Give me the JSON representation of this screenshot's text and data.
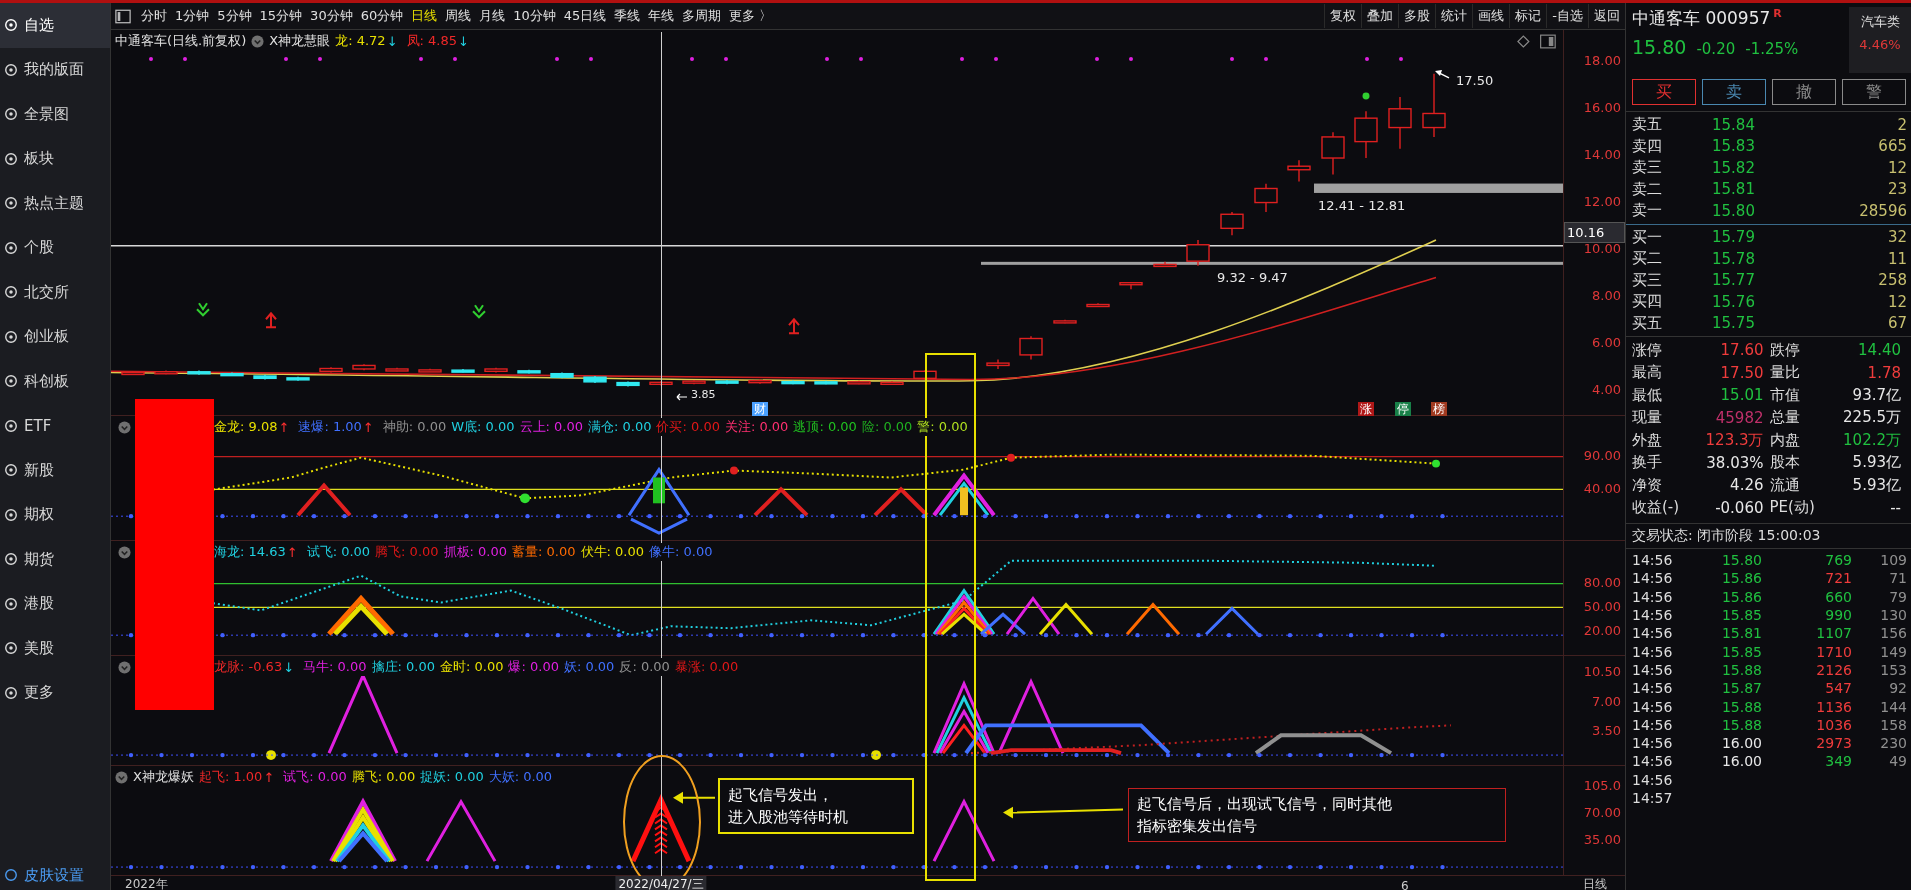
{
  "sidebar": {
    "items": [
      {
        "label": "自选",
        "selected": true
      },
      {
        "label": "我的版面",
        "selected": false
      },
      {
        "label": "全景图",
        "selected": false
      },
      {
        "label": "板块",
        "selected": false
      },
      {
        "label": "热点主题",
        "selected": false
      },
      {
        "label": "个股",
        "selected": false
      },
      {
        "label": "北交所",
        "selected": false
      },
      {
        "label": "创业板",
        "selected": false
      },
      {
        "label": "科创板",
        "selected": false
      },
      {
        "label": "ETF",
        "selected": false
      },
      {
        "label": "新股",
        "selected": false
      },
      {
        "label": "期权",
        "selected": false
      },
      {
        "label": "期货",
        "selected": false
      },
      {
        "label": "港股",
        "selected": false
      },
      {
        "label": "美股",
        "selected": false
      },
      {
        "label": "更多",
        "selected": false
      }
    ],
    "footer": "皮肤设置"
  },
  "chart_toolbar": {
    "periods": [
      {
        "label": "分时",
        "selected": false
      },
      {
        "label": "1分钟",
        "selected": false
      },
      {
        "label": "5分钟",
        "selected": false
      },
      {
        "label": "15分钟",
        "selected": false
      },
      {
        "label": "30分钟",
        "selected": false
      },
      {
        "label": "60分钟",
        "selected": false
      },
      {
        "label": "日线",
        "selected": true
      },
      {
        "label": "周线",
        "selected": false
      },
      {
        "label": "月线",
        "selected": false
      },
      {
        "label": "10分钟",
        "selected": false
      },
      {
        "label": "45日线",
        "selected": false
      },
      {
        "label": "季线",
        "selected": false
      },
      {
        "label": "年线",
        "selected": false
      },
      {
        "label": "多周期",
        "selected": false
      },
      {
        "label": "更多 〉",
        "selected": false
      }
    ],
    "tools": [
      "复权",
      "叠加",
      "多股",
      "统计",
      "画线",
      "标记",
      "-自选",
      "返回"
    ]
  },
  "main_chart": {
    "title": "中通客车(日线.前复权)",
    "indicator": "X神龙慧眼",
    "legend": [
      {
        "text": "龙: 4.72",
        "color": "#e8e000",
        "arrow": "↓",
        "arrow_up": false
      },
      {
        "text": "凤: 4.85",
        "color": "#f02828",
        "arrow": "↓",
        "arrow_up": false
      }
    ],
    "price_axis": [
      "18.00",
      "16.00",
      "14.00",
      "12.00",
      "10.00",
      "8.00",
      "6.00",
      "4.00"
    ],
    "current_price_tag": "10.16",
    "annotations": {
      "high": "17.50",
      "upper_zone": "12.41 - 12.81",
      "lower_zone": "9.32 - 9.47",
      "low": "3.85"
    },
    "markers": [
      {
        "text": "财",
        "color": "#4aa0ff"
      },
      {
        "text": "涨",
        "color": "#b01818"
      },
      {
        "text": "停",
        "color": "#188048"
      },
      {
        "text": "榜",
        "color": "#a03a20"
      }
    ]
  },
  "indicator_panels": [
    {
      "legend": [
        {
          "text": "金龙: 9.08",
          "color": "#e8e000",
          "arrow": "↑",
          "arrow_up": true
        },
        {
          "text": "速爆: 1.00",
          "color": "#4070ff",
          "arrow": "↑",
          "arrow_up": true
        },
        {
          "text": "神助: 0.00",
          "color": "#909090"
        },
        {
          "text": "W底: 0.00",
          "color": "#20d0e0"
        },
        {
          "text": "云上: 0.00",
          "color": "#e020e0"
        },
        {
          "text": "满仓: 0.00",
          "color": "#20d0e0"
        },
        {
          "text": "价买: 0.00",
          "color": "#e01818"
        },
        {
          "text": "关注: 0.00",
          "color": "#ff3070"
        },
        {
          "text": "逃顶: 0.00",
          "color": "#20c020"
        },
        {
          "text": "险: 0.00",
          "color": "#20b020"
        },
        {
          "text": "警: 0.00",
          "color": "#b0e020"
        }
      ],
      "axis": [
        "90.00",
        "40.00"
      ]
    },
    {
      "legend": [
        {
          "text": "海龙: 14.63",
          "color": "#20d0e0",
          "arrow": "↑",
          "arrow_up": true
        },
        {
          "text": "试飞: 0.00",
          "color": "#20d0e0"
        },
        {
          "text": "腾飞: 0.00",
          "color": "#e01818"
        },
        {
          "text": "抓板: 0.00",
          "color": "#e020e0"
        },
        {
          "text": "蓄量: 0.00",
          "color": "#ff6a00"
        },
        {
          "text": "伏牛: 0.00",
          "color": "#e8e000"
        },
        {
          "text": "像牛: 0.00",
          "color": "#4070ff"
        }
      ],
      "axis": [
        "80.00",
        "50.00",
        "20.00"
      ]
    },
    {
      "legend": [
        {
          "text": "龙脉: -0.63",
          "color": "#f02828",
          "arrow": "↓",
          "arrow_up": false
        },
        {
          "text": "马牛: 0.00",
          "color": "#e020e0"
        },
        {
          "text": "擒庄: 0.00",
          "color": "#20d0e0"
        },
        {
          "text": "金时: 0.00",
          "color": "#e8e000"
        },
        {
          "text": "爆: 0.00",
          "color": "#e020e0"
        },
        {
          "text": "妖: 0.00",
          "color": "#4070ff"
        },
        {
          "text": "反: 0.00",
          "color": "#909090"
        },
        {
          "text": "暴涨: 0.00",
          "color": "#e01818"
        }
      ],
      "axis": [
        "10.50",
        "7.00",
        "3.50"
      ]
    },
    {
      "title": "X神龙爆妖",
      "legend": [
        {
          "text": "起飞: 1.00",
          "color": "#f02828",
          "arrow": "↑",
          "arrow_up": true
        },
        {
          "text": "试飞: 0.00",
          "color": "#e020e0"
        },
        {
          "text": "腾飞: 0.00",
          "color": "#e8e000"
        },
        {
          "text": "捉妖: 0.00",
          "color": "#20d0e0"
        },
        {
          "text": "大妖: 0.00",
          "color": "#4070ff"
        }
      ],
      "axis": [
        "105.0",
        "70.00",
        "35.00"
      ],
      "notes": [
        [
          "起飞信号发出，",
          "进入股池等待时机"
        ],
        [
          "起飞信号后，出现试飞信号，同时其他",
          "指标密集发出信号"
        ]
      ]
    }
  ],
  "x_axis": {
    "start": "2022年",
    "cursor_date": "2022/04/27/三",
    "tick": "6",
    "period": "日线"
  },
  "quote": {
    "name": "中通客车 000957",
    "flag": "R",
    "sector": "汽车类",
    "sector_change": "4.46%",
    "price": "15.80",
    "change": "-0.20",
    "change_pct": "-1.25%",
    "buttons": [
      {
        "label": "买",
        "color": "#e03030"
      },
      {
        "label": "卖",
        "color": "#4a88b0"
      },
      {
        "label": "撤",
        "color": "#8a8a8a"
      },
      {
        "label": "警",
        "color": "#8a8a8a"
      }
    ],
    "asks": [
      {
        "label": "卖五",
        "price": "15.84",
        "volume": "2"
      },
      {
        "label": "卖四",
        "price": "15.83",
        "volume": "665"
      },
      {
        "label": "卖三",
        "price": "15.82",
        "volume": "12"
      },
      {
        "label": "卖二",
        "price": "15.81",
        "volume": "23"
      },
      {
        "label": "卖一",
        "price": "15.80",
        "volume": "28596"
      }
    ],
    "bids": [
      {
        "label": "买一",
        "price": "15.79",
        "volume": "32"
      },
      {
        "label": "买二",
        "price": "15.78",
        "volume": "11"
      },
      {
        "label": "买三",
        "price": "15.77",
        "volume": "258"
      },
      {
        "label": "买四",
        "price": "15.76",
        "volume": "12"
      },
      {
        "label": "买五",
        "price": "15.75",
        "volume": "67"
      }
    ],
    "stats": [
      {
        "label": "涨停",
        "value": "17.60",
        "color": "#f03c3c"
      },
      {
        "label": "跌停",
        "value": "14.40",
        "color": "#20c040"
      },
      {
        "label": "最高",
        "value": "17.50",
        "color": "#f03c3c"
      },
      {
        "label": "量比",
        "value": "1.78",
        "color": "#f03c3c"
      },
      {
        "label": "最低",
        "value": "15.01",
        "color": "#20c040"
      },
      {
        "label": "市值",
        "value": "93.7亿",
        "color": "#e8e8e8"
      },
      {
        "label": "现量",
        "value": "45982",
        "color": "#c0306a"
      },
      {
        "label": "总量",
        "value": "225.5万",
        "color": "#e8e8e8"
      },
      {
        "label": "外盘",
        "value": "123.3万",
        "color": "#f03c3c"
      },
      {
        "label": "内盘",
        "value": "102.2万",
        "color": "#20c040"
      },
      {
        "label": "换手",
        "value": "38.03%",
        "color": "#e8e8e8"
      },
      {
        "label": "股本",
        "value": "5.93亿",
        "color": "#e8e8e8"
      },
      {
        "label": "净资",
        "value": "4.26",
        "color": "#e8e8e8"
      },
      {
        "label": "流通",
        "value": "5.93亿",
        "color": "#e8e8e8"
      },
      {
        "label": "收益(-)",
        "value": "-0.060",
        "color": "#e8e8e8"
      },
      {
        "label": "PE(动)",
        "value": "--",
        "color": "#e8e8e8"
      }
    ],
    "status": "交易状态: 闭市阶段 15:00:03",
    "trades": [
      {
        "time": "14:56",
        "price": "15.80",
        "below_close": true,
        "volume": "769",
        "buyer_initiated": false,
        "count": "109"
      },
      {
        "time": "14:56",
        "price": "15.86",
        "below_close": true,
        "volume": "721",
        "buyer_initiated": true,
        "count": "71"
      },
      {
        "time": "14:56",
        "price": "15.86",
        "below_close": true,
        "volume": "660",
        "buyer_initiated": false,
        "count": "79"
      },
      {
        "time": "14:56",
        "price": "15.85",
        "below_close": true,
        "volume": "990",
        "buyer_initiated": false,
        "count": "130"
      },
      {
        "time": "14:56",
        "price": "15.81",
        "below_close": true,
        "volume": "1107",
        "buyer_initiated": false,
        "count": "156"
      },
      {
        "time": "14:56",
        "price": "15.85",
        "below_close": true,
        "volume": "1710",
        "buyer_initiated": true,
        "count": "149"
      },
      {
        "time": "14:56",
        "price": "15.88",
        "below_close": true,
        "volume": "2126",
        "buyer_initiated": true,
        "count": "153"
      },
      {
        "time": "14:56",
        "price": "15.87",
        "below_close": true,
        "volume": "547",
        "buyer_initiated": true,
        "count": "92"
      },
      {
        "time": "14:56",
        "price": "15.88",
        "below_close": true,
        "volume": "1136",
        "buyer_initiated": true,
        "count": "144"
      },
      {
        "time": "14:56",
        "price": "15.88",
        "below_close": true,
        "volume": "1036",
        "buyer_initiated": true,
        "count": "158"
      },
      {
        "time": "14:56",
        "price": "16.00",
        "below_close": false,
        "volume": "2973",
        "buyer_initiated": true,
        "count": "230"
      },
      {
        "time": "14:56",
        "price": "16.00",
        "below_close": false,
        "volume": "349",
        "buyer_initiated": false,
        "count": "49"
      },
      {
        "time": "14:56"
      },
      {
        "time": "14:57"
      }
    ]
  }
}
